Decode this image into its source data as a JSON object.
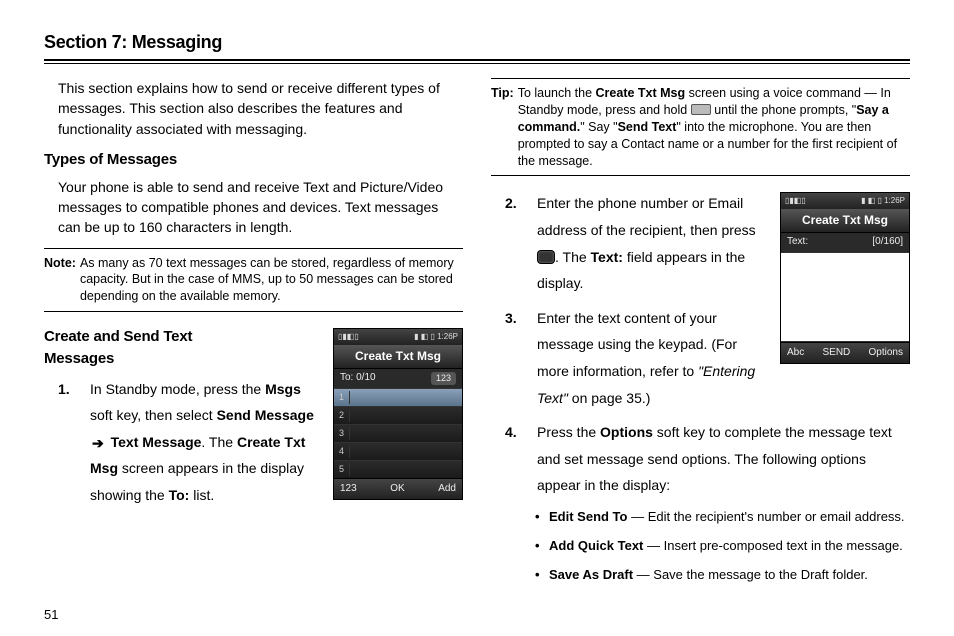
{
  "section_title": "Section 7: Messaging",
  "page_number": "51",
  "left": {
    "intro": "This section explains how to send or receive different types of messages. This section also describes the features and functionality associated with messaging.",
    "types_heading": "Types of Messages",
    "types_para": "Your phone is able to send and receive Text and Picture/Video messages to compatible phones and devices. Text messages can be up to 160 characters in length.",
    "note_label": "Note:",
    "note_text": "As many as 70 text messages can be stored, regardless of memory capacity. But in the case of MMS, up to 50 messages can be stored depending on the available memory.",
    "create_heading": "Create and Send Text Messages",
    "step1_num": "1.",
    "step1_a": "In Standby mode, press the ",
    "step1_b": "Msgs",
    "step1_c": " soft key, then select ",
    "step1_d": "Send Message",
    "step1_e": "Text Message",
    "step1_f": ". The ",
    "step1_g": "Create Txt Msg",
    "step1_h": " screen appears in the display showing the ",
    "step1_i": "To:",
    "step1_j": " list."
  },
  "right": {
    "tip_label": "Tip:",
    "tip_a": "To launch the ",
    "tip_b": "Create Txt Msg",
    "tip_c": " screen using a voice command — In Standby mode, press and hold ",
    "tip_d": " until the phone prompts, \"",
    "tip_e": "Say a command.",
    "tip_f": "\" Say \"",
    "tip_g": "Send Text",
    "tip_h": "\" into the microphone. You are then prompted to say a Contact name or a number for the first recipient of the message.",
    "step2_num": "2.",
    "step2_a": "Enter the phone number or Email address of the recipient, then press ",
    "step2_b": ". The ",
    "step2_c": "Text:",
    "step2_d": " field appears in the display.",
    "step3_num": "3.",
    "step3_a": "Enter the text content of your message using the keypad. (For more information, refer to ",
    "step3_b": "\"Entering Text\"",
    "step3_c": "  on page 35.)",
    "step4_num": "4.",
    "step4_a": "Press the ",
    "step4_b": "Options",
    "step4_c": " soft key to complete the message text and set message send options. The following options appear in the display:",
    "bullet1_b": "Edit Send To",
    "bullet1_t": " — Edit the recipient's number or email address.",
    "bullet2_b": "Add Quick Text",
    "bullet2_t": " — Insert pre-composed text in the message.",
    "bullet3_b": "Save As Draft",
    "bullet3_t": " — Save the message to the Draft folder."
  },
  "phone1": {
    "status_left": "▯▮◧▯",
    "status_right": "▮ ◧ ▯  1:26P",
    "title": "Create Txt Msg",
    "info_left": "To:  0/10",
    "info_pill": "123",
    "rows": [
      "1",
      "2",
      "3",
      "4",
      "5"
    ],
    "soft_left": "123",
    "soft_mid": "OK",
    "soft_right": "Add"
  },
  "phone2": {
    "status_left": "▯▮◧▯",
    "status_right": "▮ ◧ ▯  1:26P",
    "title": "Create Txt Msg",
    "info_left": "Text:",
    "info_right": "[0/160]",
    "soft_left": "Abc",
    "soft_mid": "SEND",
    "soft_right": "Options"
  }
}
